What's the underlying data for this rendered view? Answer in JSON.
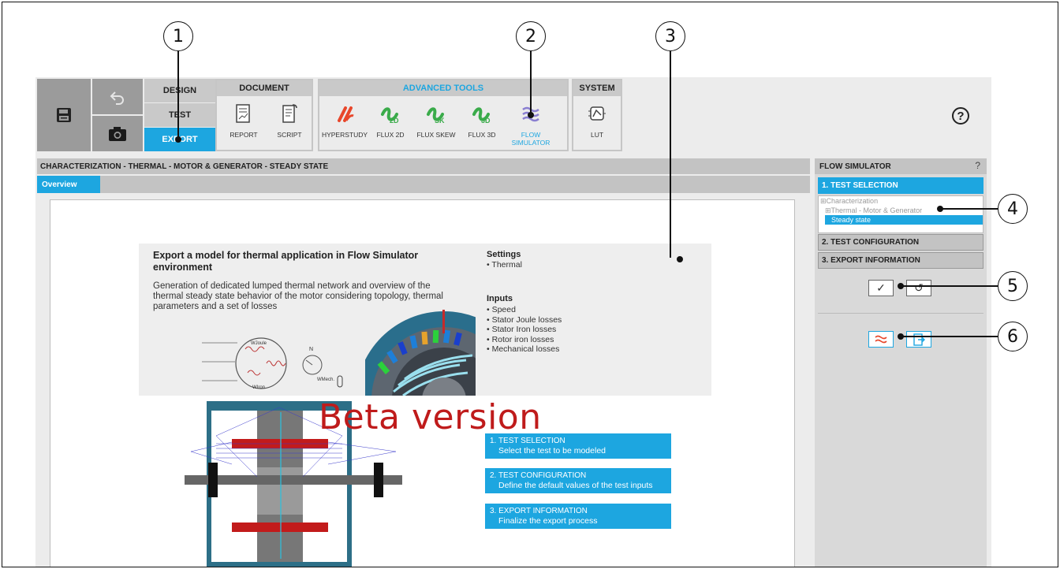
{
  "callouts": [
    "1",
    "2",
    "3",
    "4",
    "5",
    "6"
  ],
  "toolbar": {
    "modes": [
      "DESIGN",
      "TEST",
      "EXPORT"
    ],
    "active_mode": "EXPORT",
    "document_group": {
      "title": "DOCUMENT",
      "tools": [
        "REPORT",
        "SCRIPT"
      ]
    },
    "advanced_group": {
      "title": "ADVANCED TOOLS",
      "tools": [
        "HYPERSTUDY",
        "FLUX 2D",
        "FLUX SKEW",
        "FLUX 3D",
        "FLOW SIMULATOR"
      ],
      "active_tool": "FLOW SIMULATOR"
    },
    "system_group": {
      "title": "SYSTEM",
      "tools": [
        "LUT"
      ]
    },
    "help_label": "?"
  },
  "main": {
    "header": "CHARACTERIZATION - THERMAL - MOTOR & GENERATOR - STEADY STATE",
    "tab": "Overview",
    "overview": {
      "title": "Export a model for thermal application in Flow Simulator environment",
      "description": "Generation of dedicated lumped thermal network and overview of the thermal steady state behavior of the motor considering topology, thermal parameters and a set of losses",
      "settings_heading": "Settings",
      "settings": [
        "Thermal"
      ],
      "inputs_heading": "Inputs",
      "inputs": [
        "Speed",
        "Stator Joule losses",
        "Stator Iron losses",
        "Rotor iron losses",
        "Mechanical losses"
      ],
      "diagram_labels": {
        "n": "N",
        "joule": "WJoule",
        "mech": "WMech.",
        "iron": "WIron"
      },
      "beta": "Beta version",
      "steps": [
        {
          "title": "1. TEST SELECTION",
          "sub": "Select the test to be modeled"
        },
        {
          "title": "2. TEST CONFIGURATION",
          "sub": "Define the default values of the test inputs"
        },
        {
          "title": "3. EXPORT INFORMATION",
          "sub": "Finalize the export process"
        }
      ]
    }
  },
  "panel": {
    "title": "FLOW SIMULATOR",
    "help": "?",
    "sections": [
      "1. TEST SELECTION",
      "2. TEST CONFIGURATION",
      "3. EXPORT INFORMATION"
    ],
    "tree": [
      "⊞Characterization",
      "⊞Thermal - Motor & Generator",
      "Steady state"
    ],
    "buttons": {
      "validate": "✓",
      "reset": "↺"
    },
    "colors": {
      "accent": "#1da6e0",
      "beta": "#bf1b1b",
      "hyperstudy": "#e8472b",
      "flux": "#3aab4a",
      "flow": "#8a7fd1"
    }
  }
}
